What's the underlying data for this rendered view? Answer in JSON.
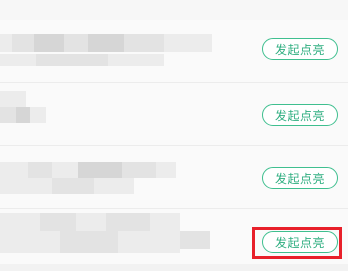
{
  "rows": [
    {
      "button_label": "发起点亮"
    },
    {
      "button_label": "发起点亮"
    },
    {
      "button_label": "发起点亮"
    },
    {
      "button_label": "发起点亮"
    }
  ],
  "colors": {
    "accent": "#2fae80",
    "highlight": "#e8202a"
  }
}
